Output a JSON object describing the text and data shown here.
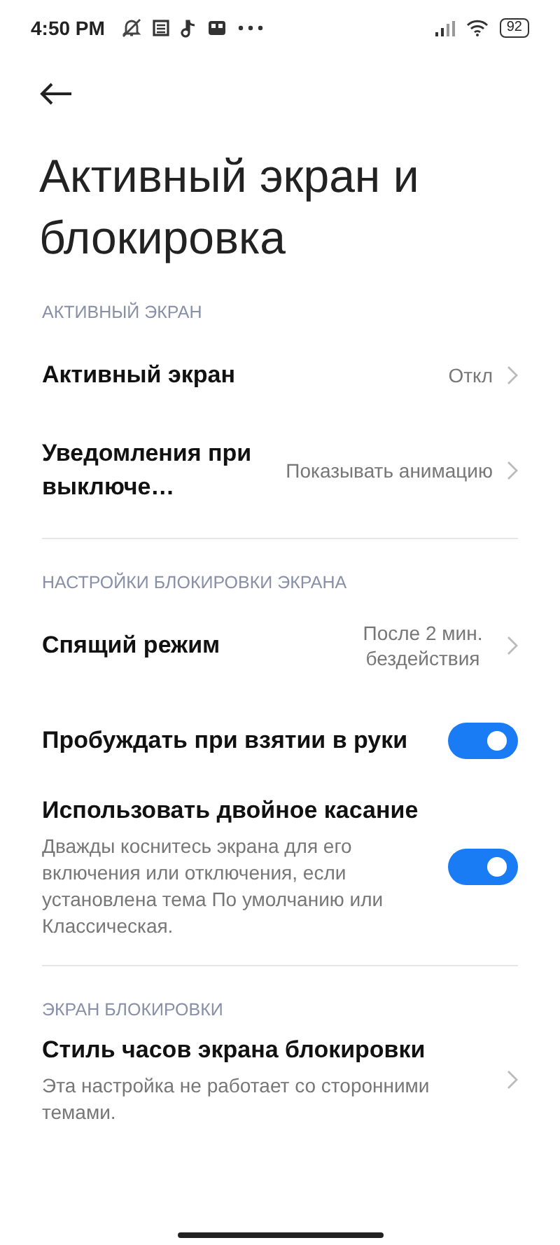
{
  "status_bar": {
    "time": "4:50 PM",
    "battery": "92"
  },
  "title": "Активный экран и блокировка",
  "sections": [
    {
      "header": "АКТИВНЫЙ ЭКРАН",
      "items": [
        {
          "kind": "link",
          "title": "Активный экран",
          "value": "Откл"
        },
        {
          "kind": "link",
          "title": "Уведомления при выключе…",
          "value": "Показывать анимацию"
        }
      ]
    },
    {
      "header": "НАСТРОЙКИ БЛОКИРОВКИ ЭКРАНА",
      "items": [
        {
          "kind": "link",
          "title": "Спящий режим",
          "value": "После 2 мин. бездействия"
        },
        {
          "kind": "toggle",
          "title": "Пробуждать при взятии в руки",
          "on": true
        },
        {
          "kind": "toggle",
          "title": "Использовать двойное касание",
          "description": "Дважды коснитесь экрана для его включения или отключения, если установлена тема По умолчанию или Классическая.",
          "on": true
        }
      ]
    },
    {
      "header": "ЭКРАН БЛОКИРОВКИ",
      "items": [
        {
          "kind": "link",
          "title": "Стиль часов экрана блокировки",
          "description": "Эта настройка не работает со сторонними темами."
        }
      ]
    }
  ]
}
